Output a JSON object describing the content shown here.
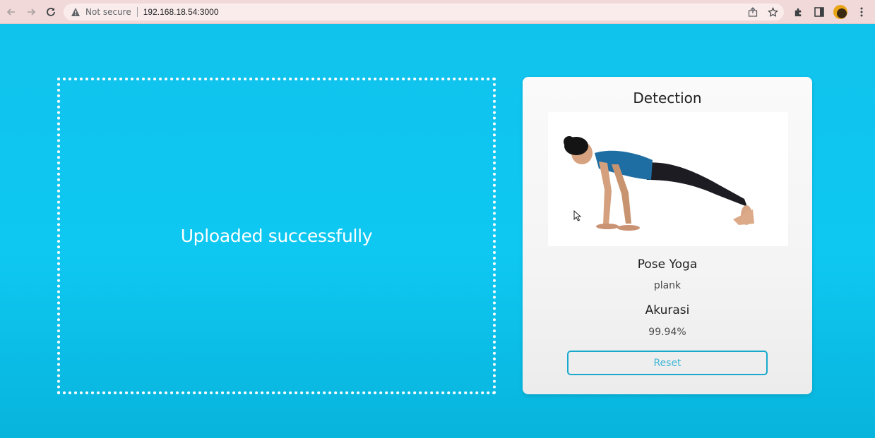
{
  "browser": {
    "not_secure_label": "Not secure",
    "url": "192.168.18.54:3000",
    "icons": [
      "back-icon",
      "forward-icon",
      "reload-icon",
      "warning-icon",
      "share-icon",
      "star-icon",
      "extensions-icon",
      "sidepanel-icon",
      "avatar",
      "menu-icon"
    ]
  },
  "upload": {
    "message": "Uploaded successfully"
  },
  "detection": {
    "title": "Detection",
    "pose_heading": "Pose Yoga",
    "pose_value": "plank",
    "accuracy_heading": "Akurasi",
    "accuracy_value": "99.94%",
    "reset_label": "Reset"
  },
  "colors": {
    "page_background": "#0ec8f2",
    "card_background": "#f5f5f5",
    "reset_border": "#19a9cc",
    "dropzone_border": "#ffffff"
  }
}
